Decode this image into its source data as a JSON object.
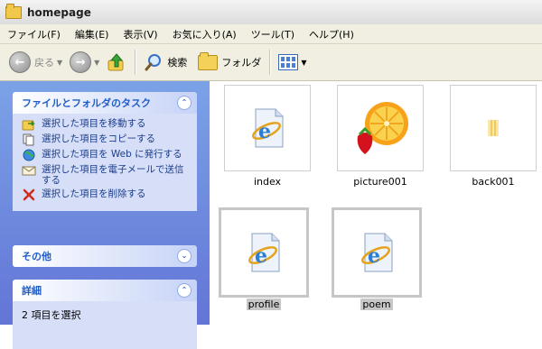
{
  "window": {
    "title": "homepage"
  },
  "menu": [
    "ファイル(F)",
    "編集(E)",
    "表示(V)",
    "お気に入り(A)",
    "ツール(T)",
    "ヘルプ(H)"
  ],
  "toolbar": {
    "back_label": "戻る",
    "search_label": "検索",
    "folders_label": "フォルダ"
  },
  "left_pane": {
    "tasks": {
      "title": "ファイルとフォルダのタスク",
      "items": [
        {
          "label": "選択した項目を移動する",
          "icon": "move-icon"
        },
        {
          "label": "選択した項目をコピーする",
          "icon": "copy-icon"
        },
        {
          "label": "選択した項目を Web に発行する",
          "icon": "publish-web-icon"
        },
        {
          "label": "選択した項目を電子メールで送信する",
          "icon": "email-icon"
        },
        {
          "label": "選択した項目を削除する",
          "icon": "delete-icon"
        }
      ]
    },
    "other": {
      "title": "その他"
    },
    "details": {
      "title": "詳細",
      "text": "2 項目を選択"
    }
  },
  "files": [
    {
      "name": "index",
      "type": "html",
      "selected": false
    },
    {
      "name": "picture001",
      "type": "image",
      "selected": false
    },
    {
      "name": "back001",
      "type": "image",
      "selected": false
    },
    {
      "name": "profile",
      "type": "html",
      "selected": true
    },
    {
      "name": "poem",
      "type": "html",
      "selected": true
    }
  ],
  "colors": {
    "pane_gradient_top": "#7ba2e7",
    "pane_gradient_bottom": "#6375d6",
    "task_text": "#1b3d8c",
    "panel_header_text": "#215dc6"
  }
}
